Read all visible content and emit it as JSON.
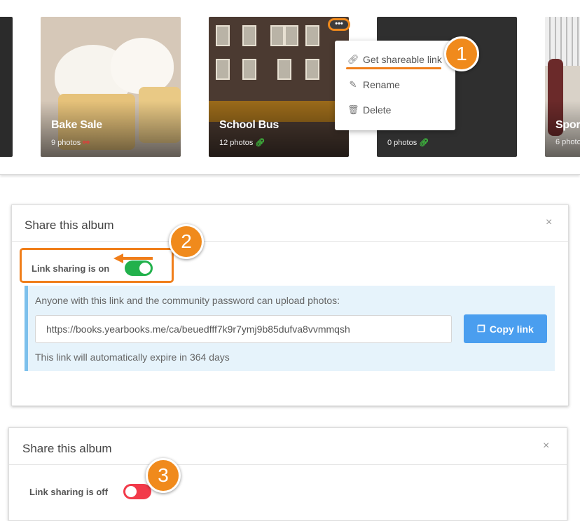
{
  "albums": [
    {
      "name": "Bake Sale",
      "count": "9 photos",
      "link_icon": "link-broken-icon",
      "link_color": "#e23a3a"
    },
    {
      "name": "School Bus",
      "count": "12 photos",
      "link_icon": "link-icon",
      "link_color": "#3fbf3f"
    },
    {
      "name": "",
      "count": "0 photos",
      "link_icon": "link-icon",
      "link_color": "#3fbf3f"
    },
    {
      "name": "Spor",
      "count": "6 photo",
      "link_icon": "",
      "link_color": ""
    }
  ],
  "album_menu": {
    "more_label": "•••",
    "items": [
      {
        "label": "Get shareable link",
        "icon": "link-icon"
      },
      {
        "label": "Rename",
        "icon": "edit-icon"
      },
      {
        "label": "Delete",
        "icon": "trash-icon"
      }
    ]
  },
  "steps": [
    "1",
    "2",
    "3"
  ],
  "share_on": {
    "title": "Share this album",
    "close": "×",
    "toggle_label": "Link sharing is on",
    "info": "Anyone with this link and the community password can upload photos:",
    "url": "https://books.yearbooks.me/ca/beuedfff7k9r7ymj9b85dufva8vvmmqsh",
    "copy_label": "Copy link",
    "expire": "This link will automatically expire in 364 days"
  },
  "share_off": {
    "title": "Share this album",
    "close": "×",
    "toggle_label": "Link sharing is off"
  },
  "colors": {
    "accent_orange": "#f08a1c",
    "toggle_on": "#22b14c",
    "toggle_off": "#f23a4a",
    "copy_button": "#4a9eef",
    "info_background": "#e6f3fb"
  }
}
